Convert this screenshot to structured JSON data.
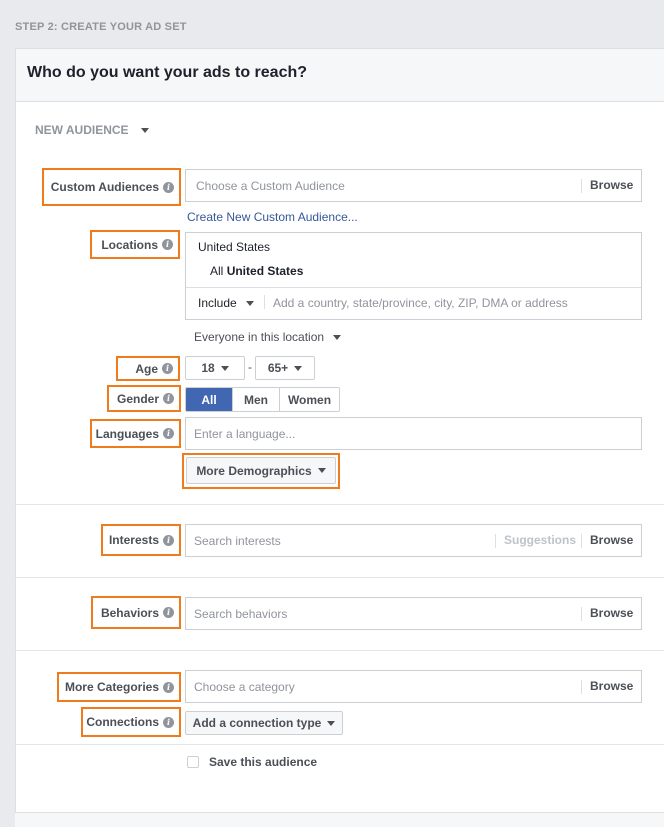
{
  "step_label": "STEP 2: CREATE YOUR AD SET",
  "card_title": "Who do you want your ads to reach?",
  "audience_dropdown": "NEW AUDIENCE",
  "custom_audiences": {
    "label": "Custom Audiences",
    "placeholder": "Choose a Custom Audience",
    "browse": "Browse",
    "create_link": "Create New Custom Audience..."
  },
  "locations": {
    "label": "Locations",
    "country": "United States",
    "sub_prefix": "All",
    "sub_country": "United States",
    "include": "Include",
    "placeholder": "Add a country, state/province, city, ZIP, DMA or address",
    "scope": "Everyone in this location"
  },
  "age": {
    "label": "Age",
    "min": "18",
    "dash": "-",
    "max": "65+"
  },
  "gender": {
    "label": "Gender",
    "options": [
      "All",
      "Men",
      "Women"
    ],
    "selected": "All"
  },
  "languages": {
    "label": "Languages",
    "placeholder": "Enter a language..."
  },
  "more_demographics": "More Demographics",
  "interests": {
    "label": "Interests",
    "placeholder": "Search interests",
    "suggestions": "Suggestions",
    "browse": "Browse"
  },
  "behaviors": {
    "label": "Behaviors",
    "placeholder": "Search behaviors",
    "browse": "Browse"
  },
  "more_categories": {
    "label": "More Categories",
    "placeholder": "Choose a category",
    "browse": "Browse"
  },
  "connections": {
    "label": "Connections",
    "button": "Add a connection type"
  },
  "save_audience": "Save this audience",
  "colors": {
    "highlight": "#f07b1d",
    "active": "#4267b2",
    "link": "#365899"
  },
  "icons": {
    "info": "info-icon",
    "dropdown": "chevron-down-icon"
  }
}
